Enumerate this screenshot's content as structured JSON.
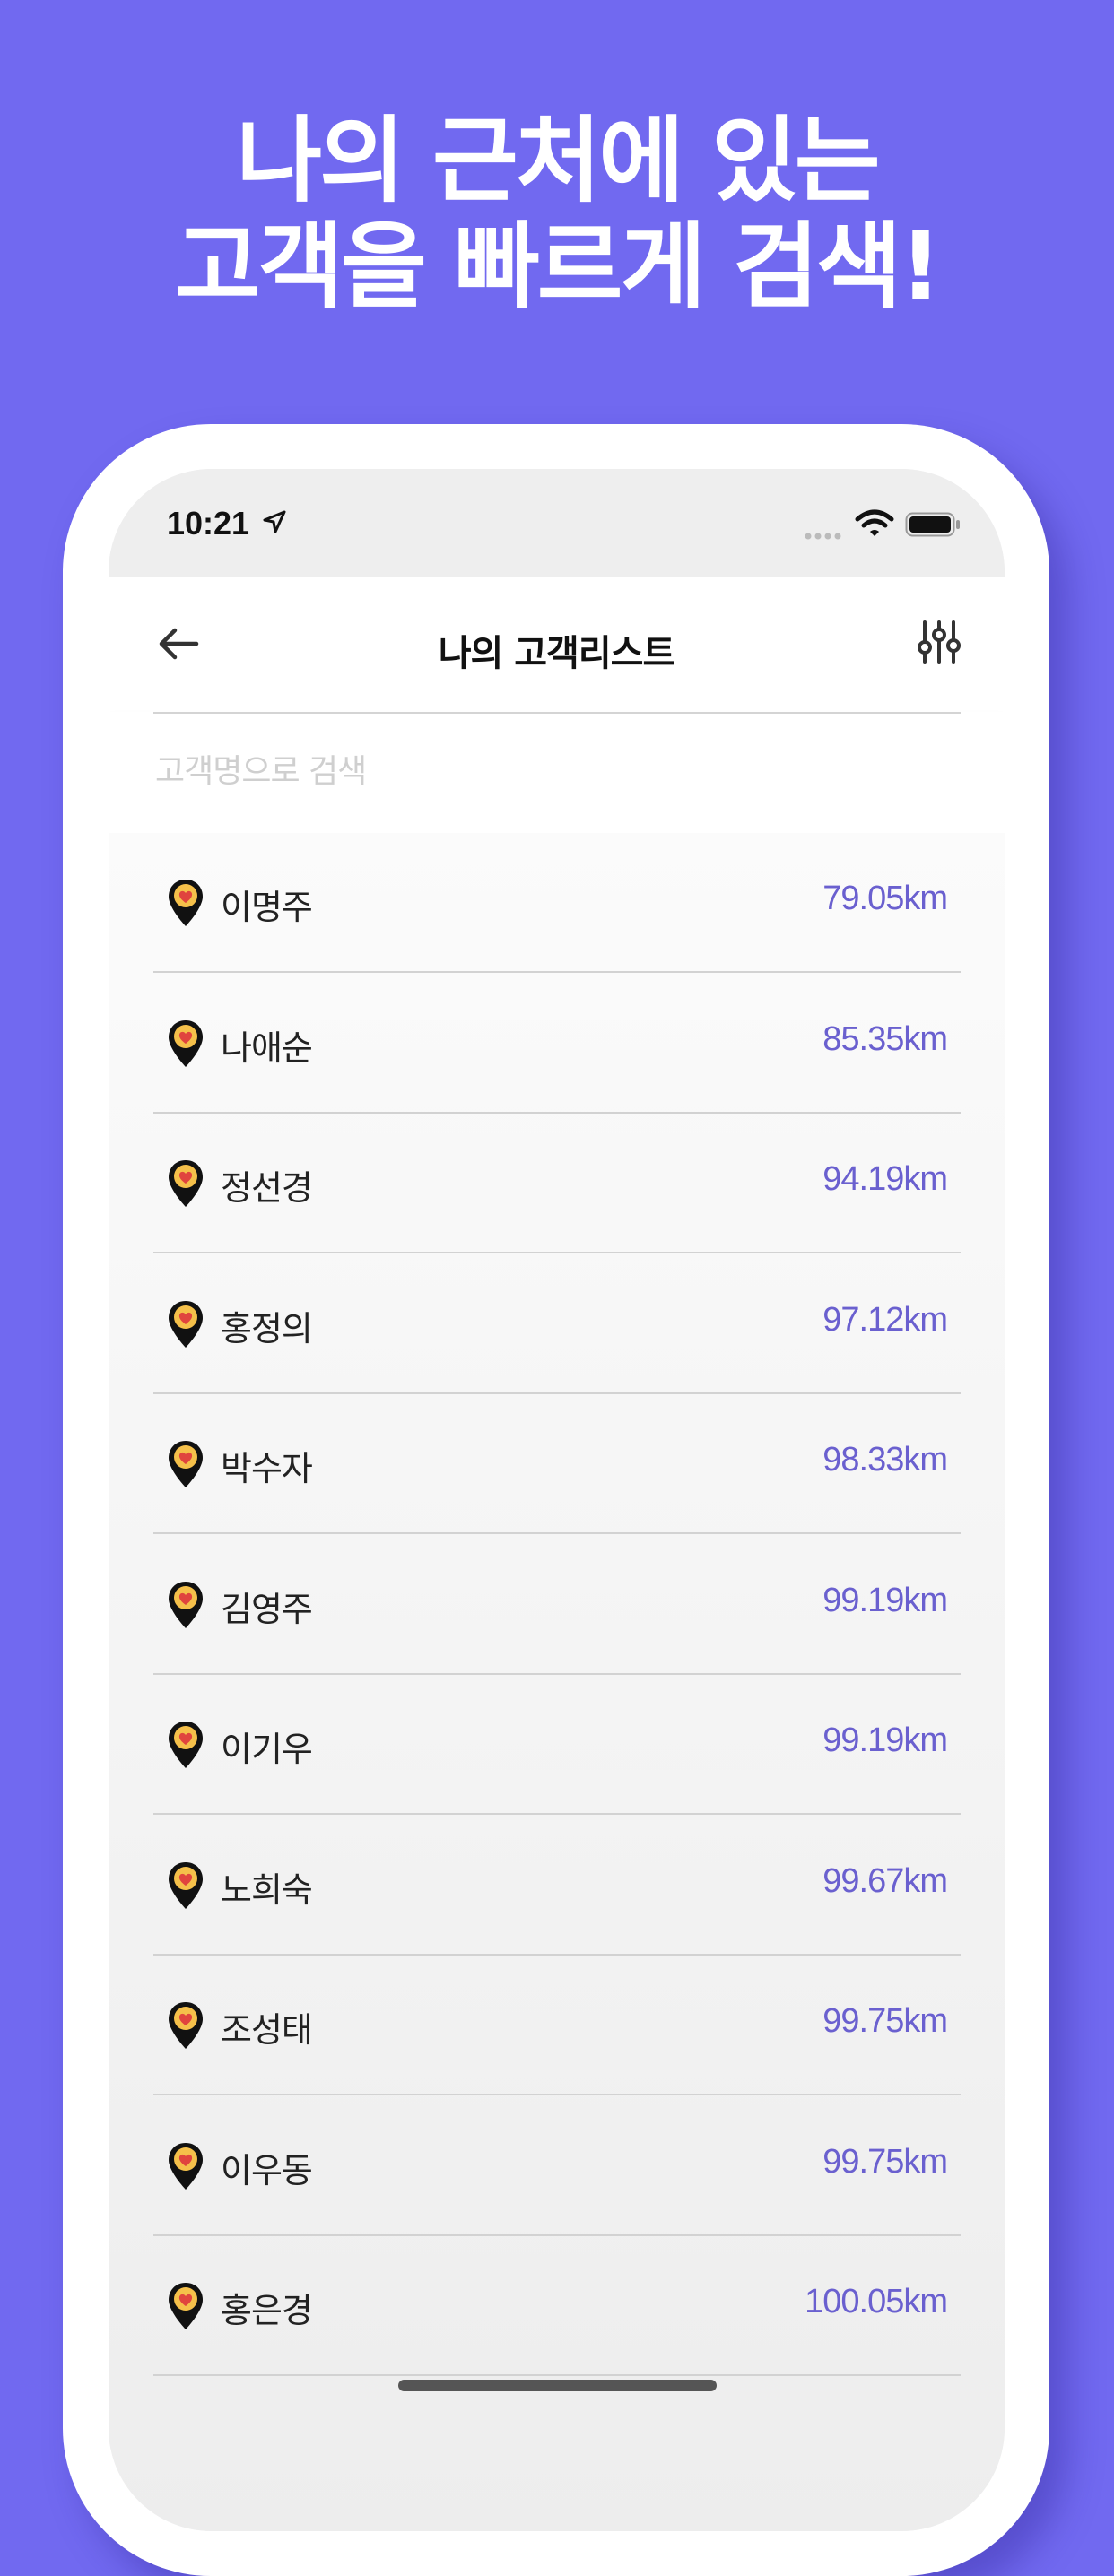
{
  "hero": {
    "line1": "나의 근처에 있는",
    "line2": "고객을 빠르게 검색!"
  },
  "status": {
    "time": "10:21"
  },
  "header": {
    "title": "나의 고객리스트"
  },
  "search": {
    "placeholder": "고객명으로 검색"
  },
  "colors": {
    "background": "#7169f0",
    "distance": "#6a60cf",
    "pin": "#f5c04a"
  },
  "icons": [
    "back-arrow-icon",
    "filter-sliders-icon",
    "location-pin-heart-icon",
    "wifi-icon",
    "battery-icon"
  ],
  "customers": [
    {
      "name": "이명주",
      "distance": "79.05km"
    },
    {
      "name": "나애순",
      "distance": "85.35km"
    },
    {
      "name": "정선경",
      "distance": "94.19km"
    },
    {
      "name": "홍정의",
      "distance": "97.12km"
    },
    {
      "name": "박수자",
      "distance": "98.33km"
    },
    {
      "name": "김영주",
      "distance": "99.19km"
    },
    {
      "name": "이기우",
      "distance": "99.19km"
    },
    {
      "name": "노희숙",
      "distance": "99.67km"
    },
    {
      "name": "조성태",
      "distance": "99.75km"
    },
    {
      "name": "이우동",
      "distance": "99.75km"
    },
    {
      "name": "홍은경",
      "distance": "100.05km"
    }
  ]
}
